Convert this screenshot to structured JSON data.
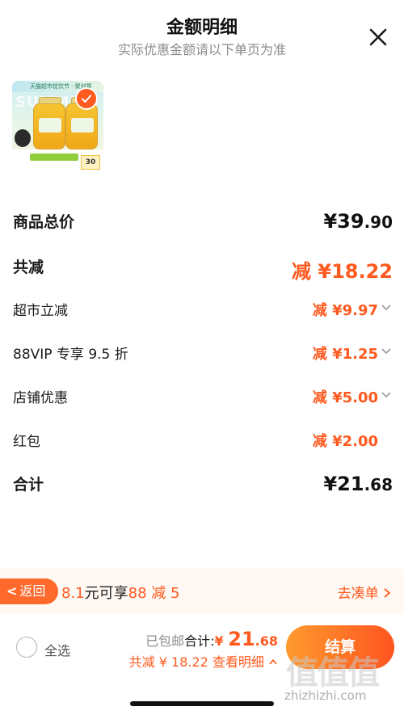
{
  "header": {
    "title": "金额明细",
    "subtitle": "实际优惠金额请以下单页为准"
  },
  "product": {
    "thumb_top_text": "天猫超市枕饮节 · 聚划算",
    "thumb_banner": "SUMMER",
    "thumb_price": "30"
  },
  "rows": {
    "total_price": {
      "label": "商品总价",
      "symbol": "¥",
      "int": "39",
      "cents": ".90"
    },
    "total_discount": {
      "label": "共减",
      "prefix": "减",
      "value": "¥18.22"
    },
    "supermarket": {
      "label": "超市立减",
      "prefix": "减",
      "value": "¥9.97"
    },
    "vip": {
      "label": "88VIP 专享 9.5 折",
      "prefix": "减",
      "value": "¥1.25"
    },
    "store": {
      "label": "店铺优惠",
      "prefix": "减",
      "value": "¥5.00"
    },
    "red_packet": {
      "label": "红包",
      "prefix": "减",
      "value": "¥2.00"
    },
    "subtotal": {
      "label": "合计",
      "symbol": "¥",
      "int": "21",
      "cents": ".68"
    }
  },
  "promo": {
    "back_label": "返回",
    "amount": "8.1",
    "middle": "元可享",
    "offer": "88 减 5",
    "link": "去凑单"
  },
  "bottom": {
    "select_all": "全选",
    "shipping": "已包邮",
    "total_label": "合计:",
    "total_symbol": "¥",
    "total_int": "21",
    "total_dec": ".68",
    "discount_text": "共减 ¥ 18.22  查看明细",
    "checkout": "结算"
  },
  "watermark": {
    "glyphs": "值值值",
    "url": "zhizhizhi.com"
  },
  "icons": {
    "close": "close-icon",
    "check": "check-icon",
    "chevron": "chevron-down-icon",
    "back": "chevron-left-icon"
  },
  "colors": {
    "accent": "#ff5a1f",
    "checkout_start": "#ff9a2e",
    "checkout_end": "#ff5520",
    "muted": "#8c8c8c"
  }
}
